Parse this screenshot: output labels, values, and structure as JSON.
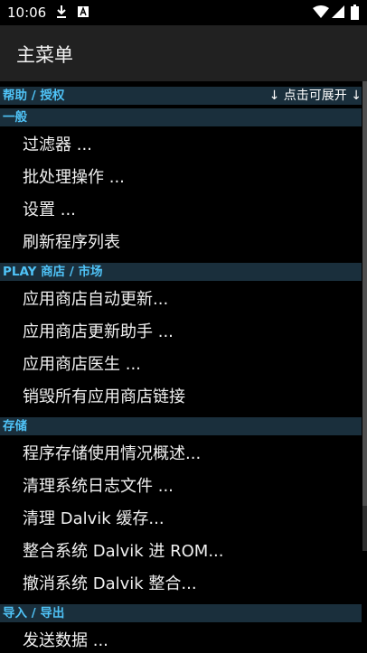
{
  "status_bar": {
    "time": "10:06"
  },
  "app_bar": {
    "title": "主菜单"
  },
  "sections": {
    "help": {
      "title": "帮助 / 授权",
      "hint": "↓ 点击可展开 ↓"
    },
    "general": {
      "title": "一般",
      "items": [
        "过滤器 ...",
        "批处理操作 ...",
        "设置 ...",
        "刷新程序列表"
      ]
    },
    "play": {
      "title": "PLAY 商店 / 市场",
      "items": [
        "应用商店自动更新...",
        "应用商店更新助手 ...",
        "应用商店医生 ...",
        "销毁所有应用商店链接"
      ]
    },
    "storage": {
      "title": "存储",
      "items": [
        "程序存储使用情况概述...",
        "清理系统日志文件 ...",
        "清理 Dalvik 缓存...",
        "整合系统 Dalvik 进 ROM...",
        "撤消系统 Dalvik 整合..."
      ]
    },
    "import_export": {
      "title": "导入 / 导出",
      "items": [
        "发送数据 ..."
      ]
    }
  }
}
